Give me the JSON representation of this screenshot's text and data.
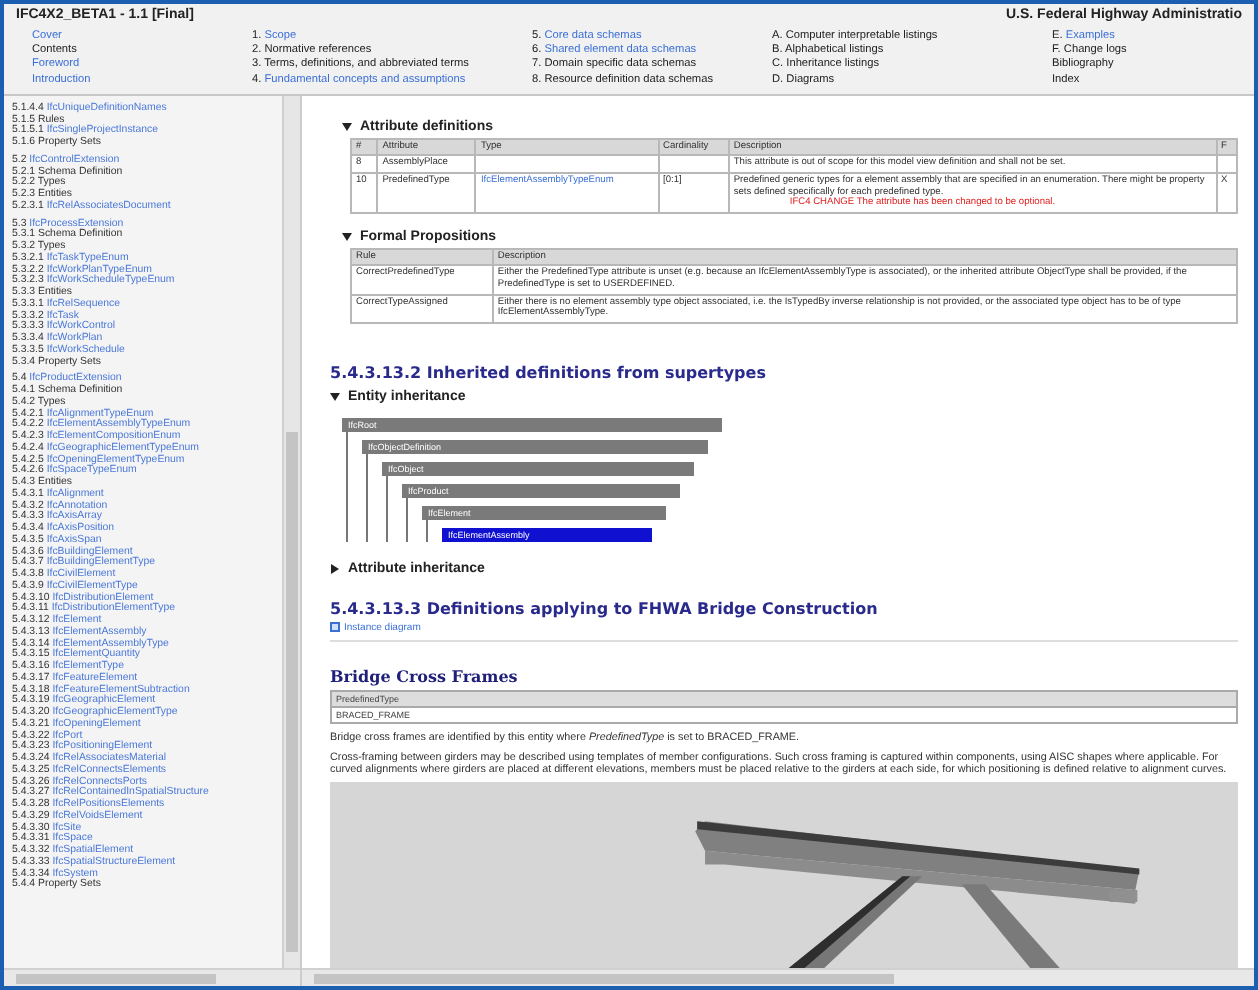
{
  "window": {
    "title": "IFC4X2_BETA1 - 1.1 [Final]",
    "organization": "U.S. Federal Highway Administratio"
  },
  "nav": [
    [
      {
        "text": "Cover",
        "link": true
      },
      {
        "text": "Contents",
        "link": false
      },
      {
        "text": "Foreword",
        "link": true
      },
      {
        "text": "Introduction",
        "link": true
      }
    ],
    [
      {
        "num": "1.",
        "text": "Scope",
        "link": true
      },
      {
        "num": "2.",
        "text": "Normative references",
        "link": false
      },
      {
        "num": "3.",
        "text": "Terms, definitions, and abbreviated terms",
        "link": false
      },
      {
        "num": "4.",
        "text": "Fundamental concepts and assumptions",
        "link": true
      }
    ],
    [
      {
        "num": "5.",
        "text": "Core data schemas",
        "link": true
      },
      {
        "num": "6.",
        "text": "Shared element data schemas",
        "link": true
      },
      {
        "num": "7.",
        "text": "Domain specific data schemas",
        "link": false
      },
      {
        "num": "8.",
        "text": "Resource definition data schemas",
        "link": false
      }
    ],
    [
      {
        "num": "A.",
        "text": "Computer interpretable listings",
        "link": false
      },
      {
        "num": "B.",
        "text": "Alphabetical listings",
        "link": false
      },
      {
        "num": "C.",
        "text": "Inheritance listings",
        "link": false
      },
      {
        "num": "D.",
        "text": "Diagrams",
        "link": false
      }
    ],
    [
      {
        "num": "E.",
        "text": "Examples",
        "link": true
      },
      {
        "num": "F.",
        "text": "Change logs",
        "link": false
      },
      {
        "text": "Bibliography",
        "link": false
      },
      {
        "text": "Index",
        "link": false
      }
    ]
  ],
  "sidebar": [
    [
      {
        "num": "5.1.4.4",
        "text": "IfcUniqueDefinitionNames",
        "link": true
      },
      {
        "num": "5.1.5",
        "text": "Rules",
        "link": false
      },
      {
        "num": "5.1.5.1",
        "text": "IfcSingleProjectInstance",
        "link": true
      },
      {
        "num": "5.1.6",
        "text": "Property Sets",
        "link": false
      }
    ],
    [
      {
        "num": "5.2",
        "text": "IfcControlExtension",
        "link": true
      },
      {
        "num": "5.2.1",
        "text": "Schema Definition",
        "link": false
      },
      {
        "num": "5.2.2",
        "text": "Types",
        "link": false
      },
      {
        "num": "5.2.3",
        "text": "Entities",
        "link": false
      },
      {
        "num": "5.2.3.1",
        "text": "IfcRelAssociatesDocument",
        "link": true
      }
    ],
    [
      {
        "num": "5.3",
        "text": "IfcProcessExtension",
        "link": true
      },
      {
        "num": "5.3.1",
        "text": "Schema Definition",
        "link": false
      },
      {
        "num": "5.3.2",
        "text": "Types",
        "link": false
      },
      {
        "num": "5.3.2.1",
        "text": "IfcTaskTypeEnum",
        "link": true
      },
      {
        "num": "5.3.2.2",
        "text": "IfcWorkPlanTypeEnum",
        "link": true
      },
      {
        "num": "5.3.2.3",
        "text": "IfcWorkScheduleTypeEnum",
        "link": true
      },
      {
        "num": "5.3.3",
        "text": "Entities",
        "link": false
      },
      {
        "num": "5.3.3.1",
        "text": "IfcRelSequence",
        "link": true
      },
      {
        "num": "5.3.3.2",
        "text": "IfcTask",
        "link": true
      },
      {
        "num": "5.3.3.3",
        "text": "IfcWorkControl",
        "link": true
      },
      {
        "num": "5.3.3.4",
        "text": "IfcWorkPlan",
        "link": true
      },
      {
        "num": "5.3.3.5",
        "text": "IfcWorkSchedule",
        "link": true
      },
      {
        "num": "5.3.4",
        "text": "Property Sets",
        "link": false
      }
    ],
    [
      {
        "num": "5.4",
        "text": "IfcProductExtension",
        "link": true
      },
      {
        "num": "5.4.1",
        "text": "Schema Definition",
        "link": false
      },
      {
        "num": "5.4.2",
        "text": "Types",
        "link": false
      },
      {
        "num": "5.4.2.1",
        "text": "IfcAlignmentTypeEnum",
        "link": true
      },
      {
        "num": "5.4.2.2",
        "text": "IfcElementAssemblyTypeEnum",
        "link": true
      },
      {
        "num": "5.4.2.3",
        "text": "IfcElementCompositionEnum",
        "link": true
      },
      {
        "num": "5.4.2.4",
        "text": "IfcGeographicElementTypeEnum",
        "link": true
      },
      {
        "num": "5.4.2.5",
        "text": "IfcOpeningElementTypeEnum",
        "link": true
      },
      {
        "num": "5.4.2.6",
        "text": "IfcSpaceTypeEnum",
        "link": true
      },
      {
        "num": "5.4.3",
        "text": "Entities",
        "link": false
      },
      {
        "num": "5.4.3.1",
        "text": "IfcAlignment",
        "link": true
      },
      {
        "num": "5.4.3.2",
        "text": "IfcAnnotation",
        "link": true
      },
      {
        "num": "5.4.3.3",
        "text": "IfcAxisArray",
        "link": true
      },
      {
        "num": "5.4.3.4",
        "text": "IfcAxisPosition",
        "link": true
      },
      {
        "num": "5.4.3.5",
        "text": "IfcAxisSpan",
        "link": true
      },
      {
        "num": "5.4.3.6",
        "text": "IfcBuildingElement",
        "link": true
      },
      {
        "num": "5.4.3.7",
        "text": "IfcBuildingElementType",
        "link": true
      },
      {
        "num": "5.4.3.8",
        "text": "IfcCivilElement",
        "link": true
      },
      {
        "num": "5.4.3.9",
        "text": "IfcCivilElementType",
        "link": true
      },
      {
        "num": "5.4.3.10",
        "text": "IfcDistributionElement",
        "link": true
      },
      {
        "num": "5.4.3.11",
        "text": "IfcDistributionElementType",
        "link": true
      },
      {
        "num": "5.4.3.12",
        "text": "IfcElement",
        "link": true
      },
      {
        "num": "5.4.3.13",
        "text": "IfcElementAssembly",
        "link": true
      },
      {
        "num": "5.4.3.14",
        "text": "IfcElementAssemblyType",
        "link": true
      },
      {
        "num": "5.4.3.15",
        "text": "IfcElementQuantity",
        "link": true
      },
      {
        "num": "5.4.3.16",
        "text": "IfcElementType",
        "link": true
      },
      {
        "num": "5.4.3.17",
        "text": "IfcFeatureElement",
        "link": true
      },
      {
        "num": "5.4.3.18",
        "text": "IfcFeatureElementSubtraction",
        "link": true
      },
      {
        "num": "5.4.3.19",
        "text": "IfcGeographicElement",
        "link": true
      },
      {
        "num": "5.4.3.20",
        "text": "IfcGeographicElementType",
        "link": true
      },
      {
        "num": "5.4.3.21",
        "text": "IfcOpeningElement",
        "link": true
      },
      {
        "num": "5.4.3.22",
        "text": "IfcPort",
        "link": true
      },
      {
        "num": "5.4.3.23",
        "text": "IfcPositioningElement",
        "link": true
      },
      {
        "num": "5.4.3.24",
        "text": "IfcRelAssociatesMaterial",
        "link": true
      },
      {
        "num": "5.4.3.25",
        "text": "IfcRelConnectsElements",
        "link": true
      },
      {
        "num": "5.4.3.26",
        "text": "IfcRelConnectsPorts",
        "link": true
      },
      {
        "num": "5.4.3.27",
        "text": "IfcRelContainedInSpatialStructure",
        "link": true
      },
      {
        "num": "5.4.3.28",
        "text": "IfcRelPositionsElements",
        "link": true
      },
      {
        "num": "5.4.3.29",
        "text": "IfcRelVoidsElement",
        "link": true
      },
      {
        "num": "5.4.3.30",
        "text": "IfcSite",
        "link": true
      },
      {
        "num": "5.4.3.31",
        "text": "IfcSpace",
        "link": true
      },
      {
        "num": "5.4.3.32",
        "text": "IfcSpatialElement",
        "link": true
      },
      {
        "num": "5.4.3.33",
        "text": "IfcSpatialStructureElement",
        "link": true
      },
      {
        "num": "5.4.3.34",
        "text": "IfcSystem",
        "link": true
      },
      {
        "num": "5.4.4",
        "text": "Property Sets",
        "link": false
      }
    ]
  ],
  "attributes": {
    "title": "Attribute definitions",
    "expanded": true,
    "columns": [
      "#",
      "Attribute",
      "Type",
      "Cardinality",
      "Description",
      "F"
    ],
    "rows": [
      {
        "num": "8",
        "attribute": "AssemblyPlace",
        "type": "",
        "cardinality": "",
        "description": "This attribute is out of scope for this model view definition and shall not be set.",
        "note": "",
        "flag": ""
      },
      {
        "num": "10",
        "attribute": "PredefinedType",
        "type": "IfcElementAssemblyTypeEnum",
        "cardinality": "[0:1]",
        "description": "Predefined generic types for a element assembly that are specified in an enumeration. There might be property sets defined specifically for each predefined type.",
        "note": "IFC4 CHANGE  The attribute has been changed to be optional.",
        "flag": "X"
      }
    ]
  },
  "propositions": {
    "title": "Formal Propositions",
    "expanded": true,
    "columns": [
      "Rule",
      "Description"
    ],
    "rows": [
      {
        "rule": "CorrectPredefinedType",
        "description": "Either the PredefinedType attribute is unset (e.g. because an IfcElementAssemblyType is associated), or the inherited attribute ObjectType shall be provided, if the PredefinedType is set to USERDEFINED."
      },
      {
        "rule": "CorrectTypeAssigned",
        "description": "Either there is no element assembly type object associated, i.e. the IsTypedBy inverse relationship is not provided, or the associated type object has to be of type IfcElementAssemblyType."
      }
    ]
  },
  "inherited": {
    "heading": "5.4.3.13.2   Inherited definitions from supertypes",
    "entity_inheritance": {
      "title": "Entity inheritance",
      "expanded": true,
      "tree": [
        {
          "name": "IfcRoot",
          "selected": false,
          "children": [
            {
              "name": "IfcObjectDefinition",
              "selected": false,
              "children": [
                {
                  "name": "IfcObject",
                  "selected": false,
                  "children": [
                    {
                      "name": "IfcProduct",
                      "selected": false,
                      "children": [
                        {
                          "name": "IfcElement",
                          "selected": false,
                          "children": [
                            {
                              "name": "IfcElementAssembly",
                              "selected": true
                            }
                          ]
                        }
                      ]
                    }
                  ]
                }
              ]
            }
          ]
        }
      ]
    },
    "attribute_inheritance": {
      "title": "Attribute inheritance",
      "expanded": false
    }
  },
  "fhwa": {
    "heading": "5.4.3.13.3   Definitions applying to FHWA Bridge Construction",
    "link": "Instance diagram"
  },
  "concept": {
    "title": "Bridge Cross Frames",
    "table": {
      "header": "PredefinedType",
      "value": "BRACED_FRAME"
    },
    "paragraphs": [
      "Bridge cross frames are identified by this entity where *PredefinedType* is set to BRACED_FRAME.",
      "Cross-framing between girders may be described using templates of member configurations. Such cross framing is captured within components, using AISC shapes where applicable. For curved alignments where girders are placed at different elevations, members must be placed relative to the girders at each side, for which positioning is defined relative to alignment curves."
    ]
  }
}
